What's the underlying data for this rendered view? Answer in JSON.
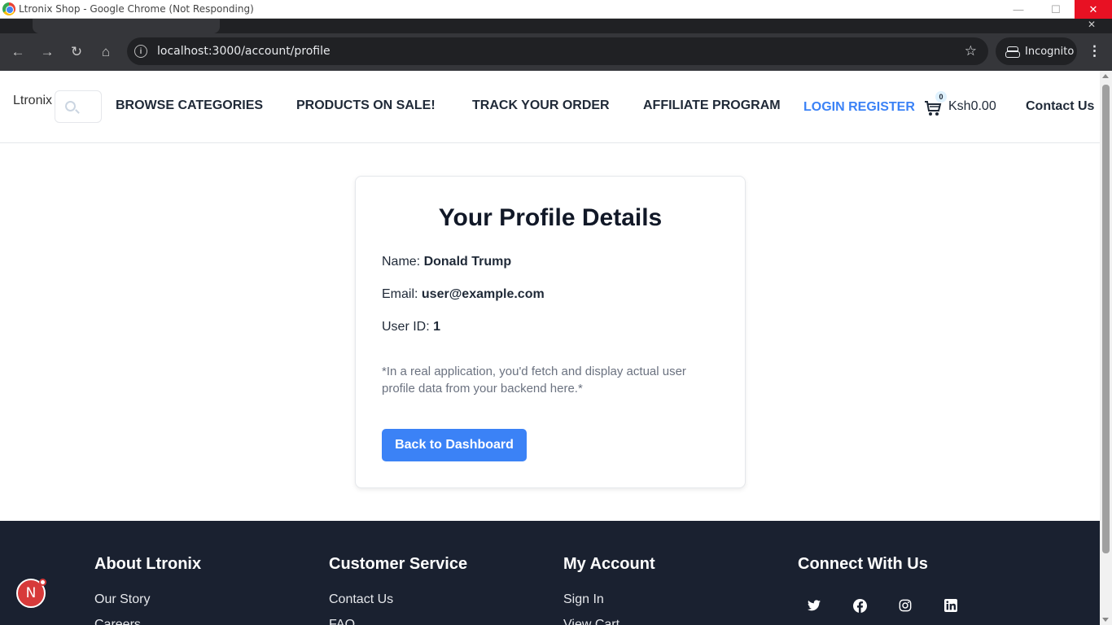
{
  "window": {
    "title": "Ltronix Shop - Google Chrome (Not Responding)",
    "min_glyph": "—",
    "max_glyph": "☐",
    "close_glyph": "✕"
  },
  "browser": {
    "url": "localhost:3000/account/profile",
    "incognito_label": "Incognito",
    "back_glyph": "←",
    "forward_glyph": "→",
    "reload_glyph": "↻",
    "home_glyph": "⌂",
    "star_glyph": "☆",
    "menu_glyph": "⋮"
  },
  "header": {
    "logo_alt": "Ltronix",
    "nav": [
      {
        "label": "BROWSE CATEGORIES"
      },
      {
        "label": "PRODUCTS ON SALE!"
      },
      {
        "label": "TRACK YOUR ORDER"
      },
      {
        "label": "AFFILIATE PROGRAM"
      },
      {
        "label": "LOGIN REGISTER"
      }
    ],
    "cart_count": "0",
    "cart_total": "Ksh0.00",
    "contact": "Contact Us"
  },
  "profile": {
    "heading": "Your Profile Details",
    "name_label": "Name:",
    "name_value": "Donald Trump",
    "email_label": "Email:",
    "email_value": "user@example.com",
    "userid_label": "User ID:",
    "userid_value": "1",
    "note": "*In a real application, you'd fetch and display actual user profile data from your backend here.*",
    "back_button": "Back to Dashboard"
  },
  "footer": {
    "columns": [
      {
        "title": "About Ltronix",
        "links": [
          "Our Story",
          "Careers"
        ]
      },
      {
        "title": "Customer Service",
        "links": [
          "Contact Us",
          "FAQ"
        ]
      },
      {
        "title": "My Account",
        "links": [
          "Sign In",
          "View Cart"
        ]
      },
      {
        "title": "Connect With Us"
      }
    ],
    "social_icons": [
      "twitter-icon",
      "facebook-icon",
      "instagram-icon",
      "linkedin-icon"
    ]
  },
  "floating_button": {
    "letter": "N"
  },
  "colors": {
    "accent": "#3b82f6",
    "footer_bg": "#1a2130",
    "browser_toolbar": "#35363a",
    "fab_red": "#d73a3a"
  }
}
